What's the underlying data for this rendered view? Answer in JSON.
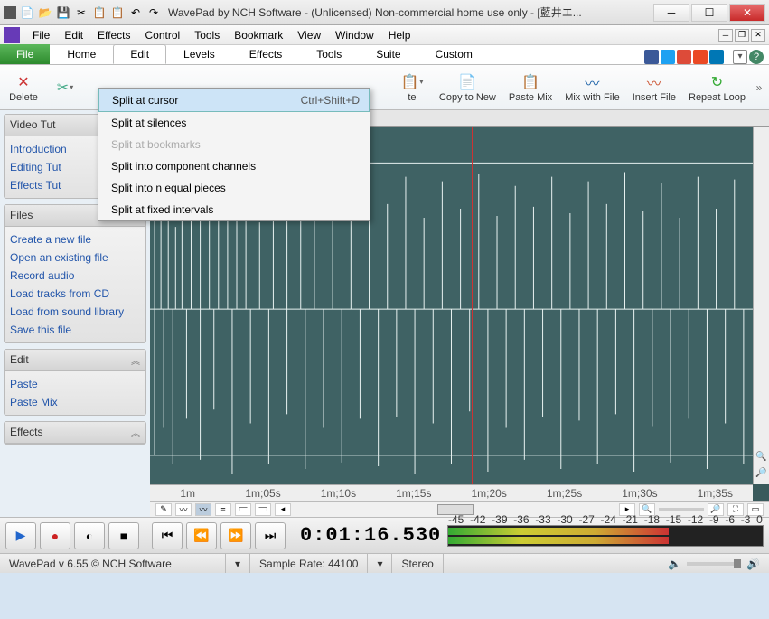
{
  "title": "WavePad by NCH Software - (Unlicensed) Non-commercial home use only - [藍井エ...",
  "menubar": [
    "File",
    "Edit",
    "Effects",
    "Control",
    "Tools",
    "Bookmark",
    "View",
    "Window",
    "Help"
  ],
  "tabs": {
    "file": "File",
    "items": [
      "Home",
      "Edit",
      "Levels",
      "Effects",
      "Tools",
      "Suite",
      "Custom"
    ],
    "active": "Edit"
  },
  "ribbon": [
    {
      "id": "delete",
      "label": "Delete",
      "icon": "✕",
      "color": "#c33"
    },
    {
      "id": "split",
      "label": "",
      "icon": "✂",
      "drop": true
    },
    {
      "id": "paste",
      "label": "te",
      "icon": "📋",
      "drop": true
    },
    {
      "id": "copynew",
      "label": "Copy to New",
      "icon": "📄"
    },
    {
      "id": "pastemix",
      "label": "Paste Mix",
      "icon": "📋"
    },
    {
      "id": "mixfile",
      "label": "Mix with File",
      "icon": "〰"
    },
    {
      "id": "insertfile",
      "label": "Insert File",
      "icon": "〰"
    },
    {
      "id": "repeatloop",
      "label": "Repeat Loop",
      "icon": "↻"
    }
  ],
  "contextmenu": [
    {
      "label": "Split at cursor",
      "shortcut": "Ctrl+Shift+D",
      "hl": true
    },
    {
      "label": "Split at silences"
    },
    {
      "label": "Split at bookmarks",
      "disabled": true
    },
    {
      "label": "Split into component channels"
    },
    {
      "label": "Split into n equal pieces"
    },
    {
      "label": "Split at fixed intervals"
    }
  ],
  "sidebar": {
    "video": {
      "title": "Video Tut",
      "items": [
        "Introduction",
        "Editing Tut",
        "Effects Tut"
      ]
    },
    "files": {
      "title": "Files",
      "items": [
        "Create a new file",
        "Open an existing file",
        "Record audio",
        "Load tracks from CD",
        "Load from sound library",
        "Save this file"
      ]
    },
    "edit": {
      "title": "Edit",
      "items": [
        "Paste",
        "Paste Mix"
      ]
    },
    "effects": {
      "title": "Effects",
      "items": []
    }
  },
  "timeline": [
    "1m",
    "1m;05s",
    "1m;10s",
    "1m;15s",
    "1m;20s",
    "1m;25s",
    "1m;30s",
    "1m;35s"
  ],
  "timecode": "0:01:16.530",
  "meter_scale": [
    "-45",
    "-42",
    "-39",
    "-36",
    "-33",
    "-30",
    "-27",
    "-24",
    "-21",
    "-18",
    "-15",
    "-12",
    "-9",
    "-6",
    "-3",
    "0"
  ],
  "status": {
    "version": "WavePad v 6.55 © NCH Software",
    "samplerate": "Sample Rate: 44100",
    "channels": "Stereo"
  }
}
